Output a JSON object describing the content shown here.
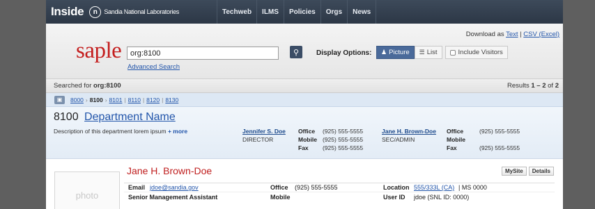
{
  "topnav": {
    "brand": "Inside",
    "logo_glyph": "n",
    "org": "Sandia National Laboratories",
    "links": [
      "Techweb",
      "ILMS",
      "Policies",
      "Orgs",
      "News"
    ]
  },
  "search": {
    "download_prefix": "Download as",
    "download_text": "Text",
    "download_divider": "|",
    "download_csv": "CSV (Excel)",
    "logo": "saple",
    "query": "org:8100",
    "search_icon": "magnifier-icon",
    "advanced": "Advanced Search",
    "display_options_label": "Display Options:",
    "picture_label": "Picture",
    "list_label": "List",
    "include_visitors_label": "Include Visitors"
  },
  "summary": {
    "searched_prefix": "Searched for",
    "searched_term": "org:8100",
    "results_prefix": "Results",
    "results_range": "1 – 2",
    "results_of": "of",
    "results_total": "2"
  },
  "breadcrumb": {
    "items": [
      "8000",
      "8100",
      "8101",
      "8110",
      "8120",
      "8130"
    ],
    "current_index": 1
  },
  "department": {
    "number": "8100",
    "name": "Department Name",
    "description": "Description of this department lorem ipsum",
    "more": "+ more",
    "contacts": [
      {
        "name": "Jennifer S. Doe",
        "role": "DIRECTOR",
        "labels": [
          "Office",
          "Mobile",
          "Fax"
        ],
        "values": [
          "(925) 555-5555",
          "(925) 555-5555",
          "(925) 555-5555"
        ]
      },
      {
        "name": "Jane H. Brown-Doe",
        "role": "SEC/ADMIN",
        "labels": [
          "Office",
          "Mobile",
          "Fax"
        ],
        "values": [
          "(925) 555-5555",
          "",
          "(925) 555-5555"
        ]
      }
    ]
  },
  "person": {
    "name": "Jane H. Brown-Doe",
    "photo_placeholder": "photo",
    "mysite": "MySite",
    "details": "Details",
    "email_label": "Email",
    "email": "jdoe@sandia.gov",
    "office_label": "Office",
    "office": "(925) 555-5555",
    "location_label": "Location",
    "location_link": "555/333L (CA)",
    "location_rest": "| MS 0000",
    "title": "Senior Management Assistant",
    "mobile_label": "Mobile",
    "userid_label": "User ID",
    "userid": "jdoe (SNL ID: 0000)"
  }
}
